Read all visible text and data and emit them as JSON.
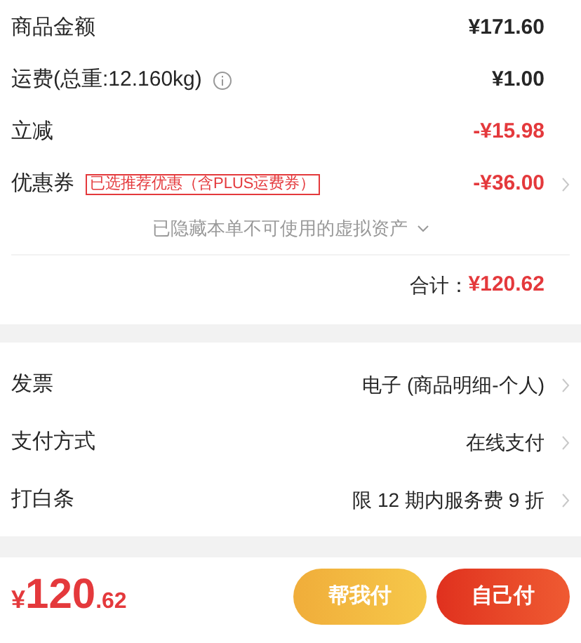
{
  "summary": [
    {
      "label": "商品金额",
      "value": "¥171.60",
      "highlight": false,
      "info": false,
      "arrow": false
    },
    {
      "label": "运费(总重:12.160kg)",
      "value": "¥1.00",
      "highlight": false,
      "info": true,
      "arrow": false
    },
    {
      "label": "立减",
      "value": "-¥15.98",
      "highlight": true,
      "info": false,
      "arrow": false
    },
    {
      "label": "优惠券",
      "tag": "已选推荐优惠（含PLUS运费券）",
      "value": "-¥36.00",
      "highlight": true,
      "info": false,
      "arrow": true
    }
  ],
  "hidden_note": "已隐藏本单不可使用的虚拟资产",
  "total": {
    "label": "合计：",
    "value": "¥120.62"
  },
  "options": [
    {
      "label": "发票",
      "value": "电子 (商品明细-个人)"
    },
    {
      "label": "支付方式",
      "value": "在线支付"
    },
    {
      "label": "打白条",
      "value": "限 12 期内服务费 9 折"
    }
  ],
  "footer": {
    "currency": "¥",
    "amount": "120",
    "decimals": ".62",
    "buttons": [
      {
        "kind": "secondary",
        "label": "帮我付"
      },
      {
        "kind": "primary",
        "label": "自己付"
      }
    ]
  }
}
